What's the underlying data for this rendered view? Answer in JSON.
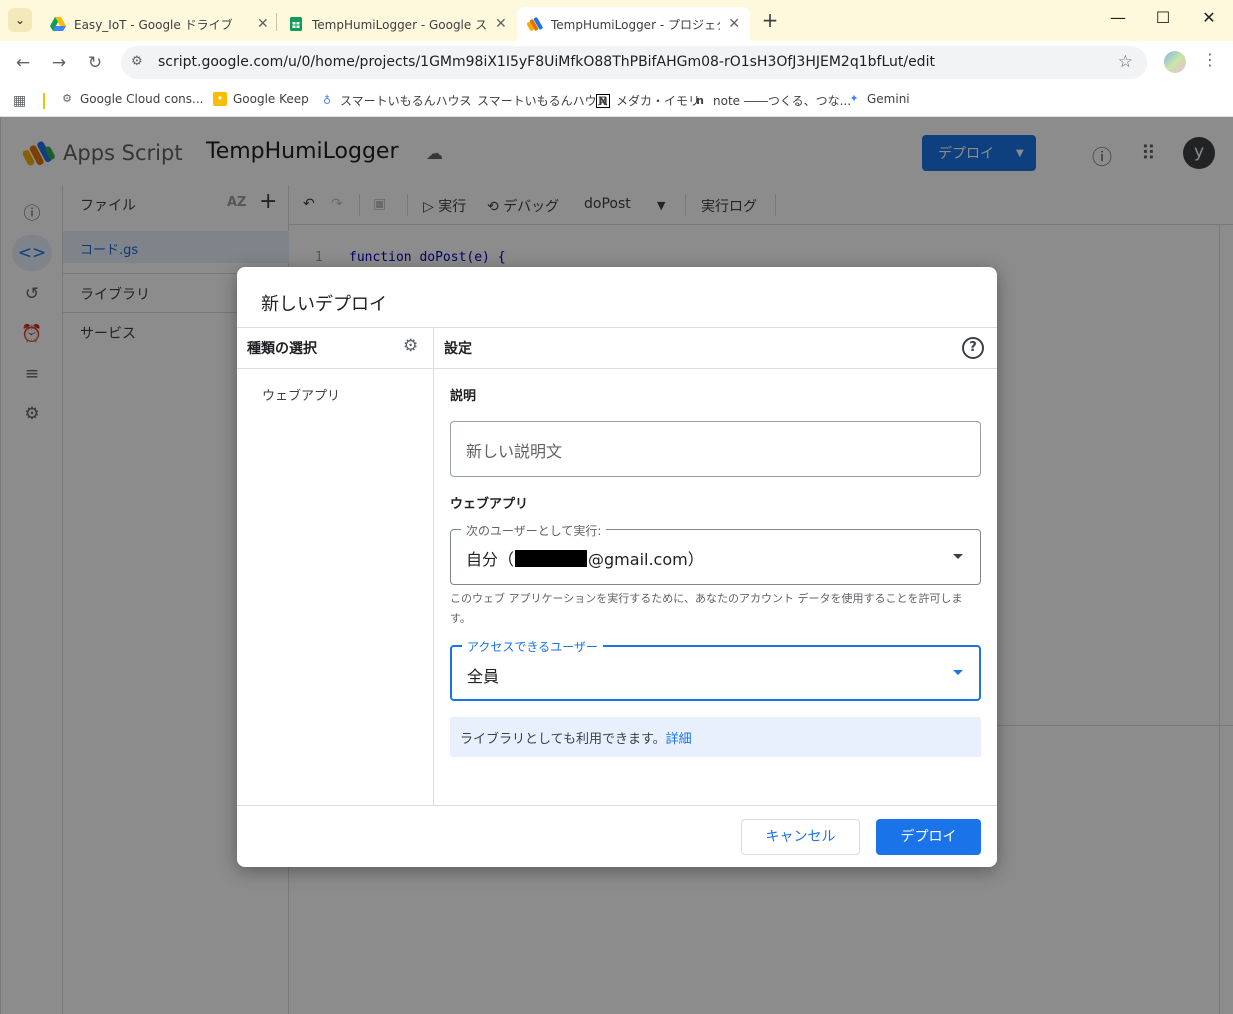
{
  "browser": {
    "tabs": [
      {
        "title": "Easy_IoT - Google ドライブ",
        "active": false
      },
      {
        "title": "TempHumiLogger - Google スプ",
        "active": false
      },
      {
        "title": "TempHumiLogger - プロジェクト編",
        "active": true
      }
    ],
    "url": "script.google.com/u/0/home/projects/1GMm98iX1I5yF8UiMfkO88ThPBifAHGm08-rO1sH3OfJ3HJEM2q1bfLut/edit",
    "bookmarks": [
      "Google Cloud cons...",
      "Google Keep",
      "スマートいもるんハウス",
      "スマートいもるんハウス",
      "メダカ・イモリ",
      "note ――つくる、つな...",
      "Gemini"
    ]
  },
  "app": {
    "product_name": "Apps Script",
    "project_name": "TempHumiLogger",
    "deploy_label": "デプロイ",
    "avatar_letter": "y"
  },
  "file_pane": {
    "title": "ファイル",
    "sort_label": "AZ",
    "file": "コード.gs",
    "sections": [
      "ライブラリ",
      "サービス"
    ]
  },
  "editor_toolbar": {
    "run": "実行",
    "debug": "デバッグ",
    "function": "doPost",
    "log": "実行ログ"
  },
  "code": {
    "line_number": "1",
    "text": "function doPost(e) {"
  },
  "dialog": {
    "title": "新しいデプロイ",
    "type_header": "種類の選択",
    "settings_header": "設定",
    "type_item": "ウェブアプリ",
    "description_label": "説明",
    "description_placeholder": "新しい説明文",
    "webapp_label": "ウェブアプリ",
    "execute_as_legend": "次のユーザーとして実行:",
    "execute_as_prefix": "自分（",
    "execute_as_suffix": "@gmail.com）",
    "execute_as_hint": "このウェブ アプリケーションを実行するために、あなたのアカウント データを使用することを許可します。",
    "access_legend": "アクセスできるユーザー",
    "access_value": "全員",
    "library_info": "ライブラリとしても利用できます。",
    "library_link": "詳細",
    "cancel_label": "キャンセル",
    "deploy_label": "デプロイ"
  },
  "colors": {
    "accent": "#1a73e8",
    "tabbar": "#fef8dc",
    "info_bg": "#e8f0fe"
  }
}
